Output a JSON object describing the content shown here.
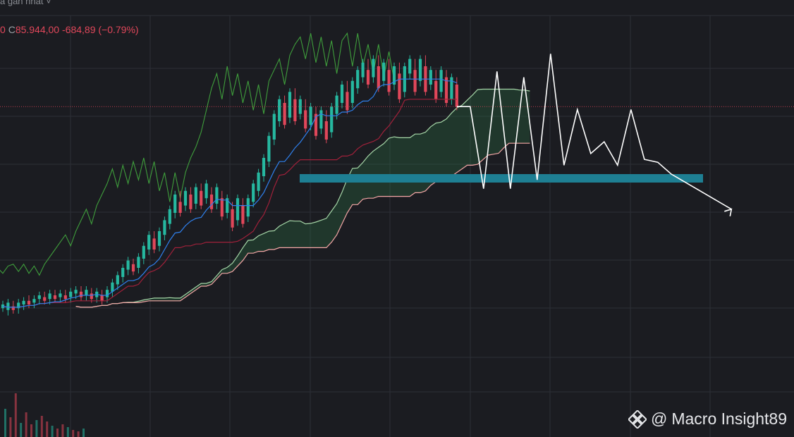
{
  "header": {
    "interval_label": "a gần nhất",
    "dropdown_icon": "chevron-down-icon"
  },
  "ohlc": {
    "open_fragment": "0",
    "close_label": "C",
    "close_value": "85.944,00",
    "change": "-684,89",
    "change_pct": "(−0.79%)"
  },
  "watermark": {
    "icon": "binance-logo-icon",
    "at": "@",
    "text": "Macro Insight89"
  },
  "colors": {
    "background": "#1b1c21",
    "grid": "#2d2f36",
    "up_candle": "#26b8a0",
    "down_candle": "#e0475a",
    "tenkan": "#2f80ed",
    "kijun": "#a0213a",
    "chikou": "#3f9e3c",
    "span_a": "#a5d6a7",
    "span_b": "#f4a6a6",
    "cloud_bull": "rgba(46,125,75,0.28)",
    "cloud_bear": "rgba(160,40,50,0.22)",
    "support_zone": "#1e7f93",
    "projection": "#ffffff",
    "price_line": "#e0475a"
  },
  "chart_data": {
    "type": "candlestick",
    "indicator": "ichimoku",
    "last_close": 85944.0,
    "change": -684.89,
    "change_pct": -0.79,
    "grid": true,
    "candles": [
      [
        1,
        0,
        0,
        -2
      ],
      [
        1,
        -3,
        -4,
        1
      ],
      [
        0,
        -1,
        0,
        -3
      ],
      [
        1,
        -2,
        -3,
        1
      ],
      [
        1,
        0,
        -1,
        2
      ],
      [
        0,
        2,
        3,
        0
      ],
      [
        1,
        1,
        0,
        3
      ],
      [
        1,
        3,
        2,
        5
      ],
      [
        0,
        4,
        5,
        2
      ],
      [
        1,
        3,
        2,
        6
      ],
      [
        0,
        5,
        6,
        3
      ],
      [
        1,
        4,
        3,
        6
      ],
      [
        0,
        5,
        6,
        3
      ],
      [
        1,
        4,
        3,
        7
      ],
      [
        1,
        6,
        5,
        8
      ],
      [
        0,
        7,
        8,
        4
      ],
      [
        1,
        5,
        4,
        8
      ],
      [
        0,
        6,
        7,
        3
      ],
      [
        1,
        4,
        3,
        7
      ],
      [
        0,
        5,
        6,
        2
      ],
      [
        1,
        4,
        3,
        8
      ],
      [
        1,
        7,
        6,
        12
      ],
      [
        1,
        11,
        10,
        16
      ],
      [
        1,
        15,
        14,
        20
      ],
      [
        1,
        19,
        18,
        24
      ],
      [
        0,
        22,
        23,
        18
      ],
      [
        1,
        20,
        19,
        26
      ],
      [
        1,
        25,
        24,
        32
      ],
      [
        1,
        30,
        29,
        38
      ],
      [
        0,
        36,
        38,
        30
      ],
      [
        1,
        32,
        31,
        40
      ],
      [
        1,
        38,
        37,
        46
      ],
      [
        1,
        44,
        43,
        52
      ],
      [
        1,
        50,
        49,
        60
      ],
      [
        0,
        56,
        60,
        50
      ],
      [
        1,
        54,
        53,
        62
      ],
      [
        0,
        60,
        62,
        52
      ],
      [
        1,
        55,
        54,
        64
      ],
      [
        0,
        62,
        64,
        54
      ],
      [
        1,
        58,
        57,
        66
      ],
      [
        0,
        60,
        62,
        52
      ],
      [
        1,
        55,
        54,
        64
      ],
      [
        0,
        58,
        60,
        48
      ],
      [
        1,
        50,
        49,
        58
      ],
      [
        0,
        52,
        54,
        42
      ],
      [
        1,
        46,
        45,
        58
      ],
      [
        0,
        54,
        56,
        44
      ],
      [
        1,
        48,
        47,
        58
      ],
      [
        1,
        56,
        55,
        66
      ],
      [
        1,
        62,
        61,
        72
      ],
      [
        1,
        70,
        69,
        80
      ],
      [
        1,
        78,
        77,
        92
      ],
      [
        1,
        90,
        89,
        104
      ],
      [
        1,
        100,
        99,
        112
      ],
      [
        0,
        110,
        112,
        98
      ],
      [
        1,
        102,
        101,
        116
      ],
      [
        0,
        112,
        116,
        100
      ],
      [
        1,
        104,
        103,
        112
      ],
      [
        0,
        106,
        110,
        96
      ],
      [
        1,
        98,
        97,
        108
      ],
      [
        0,
        104,
        106,
        92
      ],
      [
        1,
        96,
        95,
        106
      ],
      [
        0,
        100,
        104,
        90
      ],
      [
        1,
        94,
        93,
        108
      ],
      [
        1,
        104,
        103,
        114
      ],
      [
        1,
        110,
        109,
        120
      ],
      [
        0,
        116,
        120,
        106
      ],
      [
        1,
        110,
        109,
        122
      ],
      [
        1,
        118,
        117,
        128
      ],
      [
        1,
        124,
        123,
        132
      ],
      [
        0,
        128,
        132,
        120
      ],
      [
        1,
        124,
        123,
        134
      ],
      [
        0,
        130,
        134,
        118
      ],
      [
        1,
        122,
        121,
        132
      ],
      [
        0,
        128,
        132,
        116
      ],
      [
        1,
        120,
        119,
        130
      ],
      [
        0,
        126,
        130,
        112
      ],
      [
        1,
        116,
        115,
        130
      ],
      [
        1,
        126,
        125,
        134
      ],
      [
        0,
        128,
        132,
        116
      ],
      [
        1,
        122,
        121,
        134
      ],
      [
        0,
        130,
        134,
        116
      ],
      [
        1,
        120,
        119,
        128
      ],
      [
        0,
        122,
        126,
        112
      ],
      [
        1,
        116,
        115,
        128
      ],
      [
        0,
        124,
        126,
        110
      ],
      [
        1,
        112,
        111,
        124
      ],
      [
        0,
        120,
        122,
        108
      ]
    ],
    "projection_path": [
      0,
      -28,
      12,
      -28,
      10,
      -25,
      18,
      -20,
      -1,
      -16,
      -12,
      -20,
      -1,
      -18,
      -19,
      -23,
      -35
    ]
  }
}
